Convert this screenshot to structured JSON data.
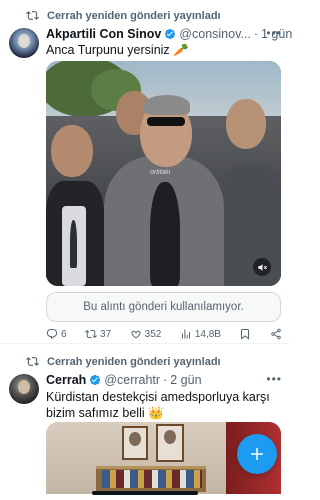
{
  "colors": {
    "accent": "#1d9bf0",
    "secondary_text": "#536471",
    "verified": "#1d9bf0"
  },
  "tweet1": {
    "repost_text": "Cerrah yeniden gönderi yayınladı",
    "name": "Akpartili Con Sinov",
    "handle": "@consinov...",
    "time": "1 gün",
    "text": "Anca Turpunu yersiniz 🥕",
    "media_watermark": "ortilaki",
    "quote_unavailable": "Bu alıntı gönderi kullanılamıyor.",
    "actions": {
      "replies": "6",
      "reposts": "37",
      "likes": "352",
      "views": "14,8B"
    }
  },
  "tweet2": {
    "repost_text": "Cerrah yeniden gönderi yayınladı",
    "name": "Cerrah",
    "handle": "@cerrahtr",
    "time": "2 gün",
    "text": "Kürdistan destekçisi amedsporluya karşı bizim safımız belli 👑"
  },
  "icons": {
    "repost": "repost-icon",
    "verified": "verified-badge-icon",
    "more": "more-icon",
    "reply": "reply-icon",
    "like": "heart-icon",
    "views": "views-icon",
    "bookmark": "bookmark-icon",
    "share": "share-icon",
    "mute": "mute-icon",
    "compose": "plus-icon"
  }
}
